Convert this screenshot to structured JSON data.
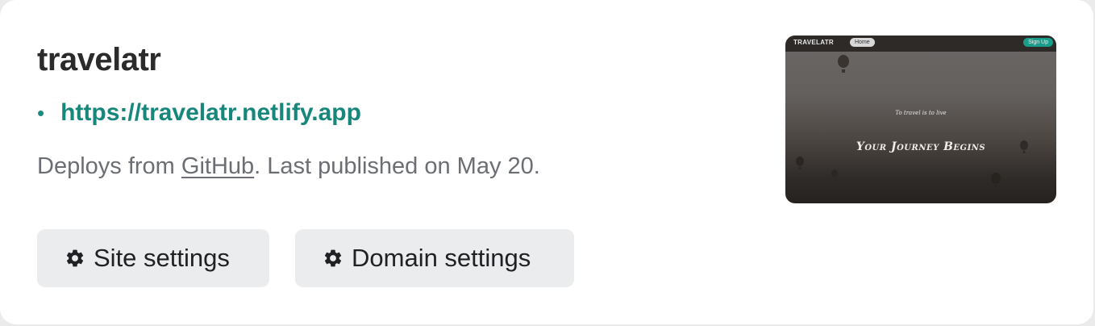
{
  "site": {
    "name": "travelatr",
    "url": "https://travelatr.netlify.app",
    "bullet": "•",
    "deploy_prefix": "Deploys from ",
    "deploy_source": "GitHub",
    "deploy_suffix": ". Last published on May 20."
  },
  "actions": {
    "site_settings_label": "Site settings",
    "domain_settings_label": "Domain settings"
  },
  "preview": {
    "logo": "TRAVELATR",
    "home_label": "Home",
    "signup_label": "Sign Up",
    "subtitle": "To travel is to live",
    "headline": "Your Journey Begins"
  },
  "colors": {
    "url": "#17877c",
    "button_bg": "#ebecee",
    "title": "#2b2b2b",
    "muted": "#6b6e73"
  },
  "icons": {
    "settings": "gear-icon"
  }
}
